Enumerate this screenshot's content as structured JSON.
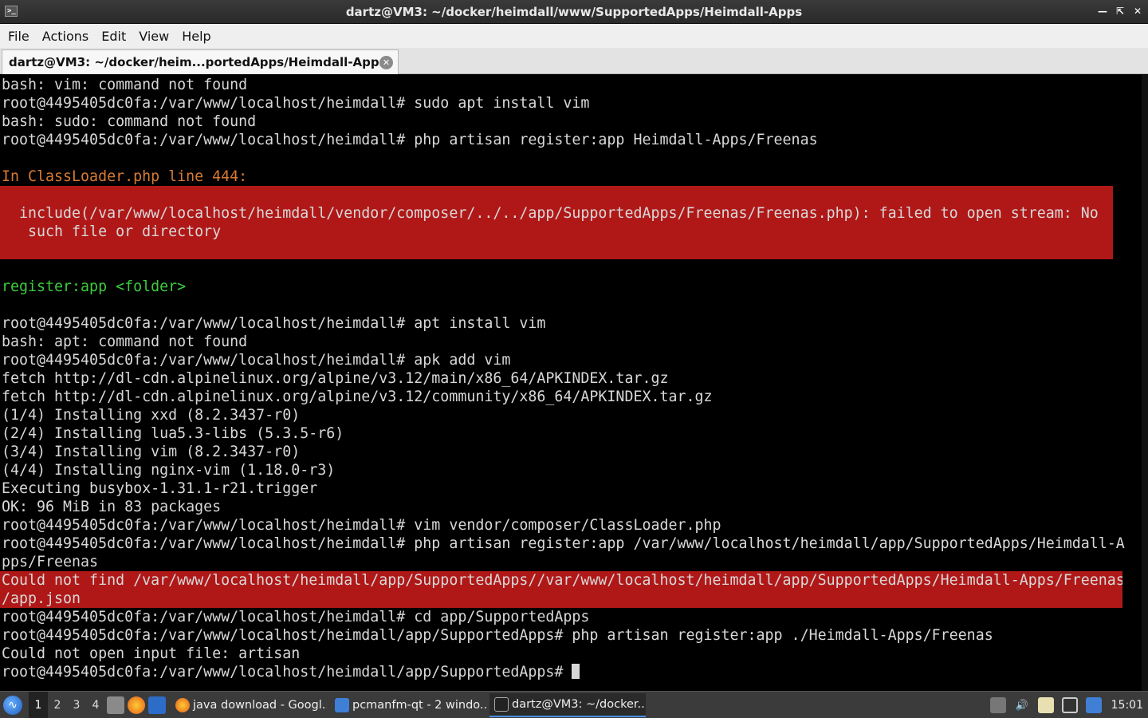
{
  "window": {
    "title": "dartz@VM3: ~/docker/heimdall/www/SupportedApps/Heimdall-Apps",
    "controls": [
      "minimize",
      "maximize",
      "close"
    ]
  },
  "menu": [
    "File",
    "Actions",
    "Edit",
    "View",
    "Help"
  ],
  "tab": {
    "label": "dartz@VM3: ~/docker/heim...portedApps/Heimdall-Apps",
    "close_icon": "close-icon"
  },
  "terminal": {
    "lines": [
      {
        "text": "bash: vim: command not found",
        "style": "plain"
      },
      {
        "text": "root@4495405dc0fa:/var/www/localhost/heimdall# sudo apt install vim",
        "style": "plain"
      },
      {
        "text": "bash: sudo: command not found",
        "style": "plain"
      },
      {
        "text": "root@4495405dc0fa:/var/www/localhost/heimdall# php artisan register:app Heimdall-Apps/Freenas",
        "style": "plain"
      },
      {
        "text": "",
        "style": "plain"
      },
      {
        "text": "In ClassLoader.php line 444:",
        "style": "orange"
      },
      {
        "text": "",
        "style": "errblock"
      },
      {
        "text": "  include(/var/www/localhost/heimdall/vendor/composer/../../app/SupportedApps/Freenas/Freenas.php): failed to open stream: No",
        "style": "errblock"
      },
      {
        "text": "   such file or directory",
        "style": "errblock"
      },
      {
        "text": "",
        "style": "errblock"
      },
      {
        "text": "",
        "style": "plain"
      },
      {
        "text": "register:app <folder>",
        "style": "green"
      },
      {
        "text": "",
        "style": "plain"
      },
      {
        "text": "root@4495405dc0fa:/var/www/localhost/heimdall# apt install vim",
        "style": "plain"
      },
      {
        "text": "bash: apt: command not found",
        "style": "plain"
      },
      {
        "text": "root@4495405dc0fa:/var/www/localhost/heimdall# apk add vim",
        "style": "plain"
      },
      {
        "text": "fetch http://dl-cdn.alpinelinux.org/alpine/v3.12/main/x86_64/APKINDEX.tar.gz",
        "style": "plain"
      },
      {
        "text": "fetch http://dl-cdn.alpinelinux.org/alpine/v3.12/community/x86_64/APKINDEX.tar.gz",
        "style": "plain"
      },
      {
        "text": "(1/4) Installing xxd (8.2.3437-r0)",
        "style": "plain"
      },
      {
        "text": "(2/4) Installing lua5.3-libs (5.3.5-r6)",
        "style": "plain"
      },
      {
        "text": "(3/4) Installing vim (8.2.3437-r0)",
        "style": "plain"
      },
      {
        "text": "(4/4) Installing nginx-vim (1.18.0-r3)",
        "style": "plain"
      },
      {
        "text": "Executing busybox-1.31.1-r21.trigger",
        "style": "plain"
      },
      {
        "text": "OK: 96 MiB in 83 packages",
        "style": "plain"
      },
      {
        "text": "root@4495405dc0fa:/var/www/localhost/heimdall# vim vendor/composer/ClassLoader.php",
        "style": "plain"
      },
      {
        "text": "root@4495405dc0fa:/var/www/localhost/heimdall# php artisan register:app /var/www/localhost/heimdall/app/SupportedApps/Heimdall-A",
        "style": "plain"
      },
      {
        "text": "pps/Freenas",
        "style": "plain"
      },
      {
        "text": "Could not find /var/www/localhost/heimdall/app/SupportedApps//var/www/localhost/heimdall/app/SupportedApps/Heimdall-Apps/Freenas",
        "style": "errred"
      },
      {
        "text": "/app.json",
        "style": "errred"
      },
      {
        "text": "root@4495405dc0fa:/var/www/localhost/heimdall# cd app/SupportedApps",
        "style": "plain"
      },
      {
        "text": "root@4495405dc0fa:/var/www/localhost/heimdall/app/SupportedApps# php artisan register:app ./Heimdall-Apps/Freenas",
        "style": "plain"
      },
      {
        "text": "Could not open input file: artisan",
        "style": "plain"
      },
      {
        "text": "root@4495405dc0fa:/var/www/localhost/heimdall/app/SupportedApps# ",
        "style": "prompt"
      }
    ]
  },
  "taskbar": {
    "start_icon": "start-menu-icon",
    "workspaces": [
      "1",
      "2",
      "3",
      "4"
    ],
    "active_workspace": "1",
    "quick_launch": [
      "file-manager-icon",
      "firefox-icon",
      "show-desktop-icon"
    ],
    "tasks": [
      {
        "label": "java download - Googl...",
        "icon": "firefox-icon",
        "active": false
      },
      {
        "label": "pcmanfm-qt - 2 windo...",
        "icon": "folder-icon",
        "active": false
      },
      {
        "label": "dartz@VM3: ~/docker...",
        "icon": "terminal-icon",
        "active": true
      }
    ],
    "tray": [
      "network-icon",
      "volume-icon",
      "clipboard-icon",
      "display-icon",
      "update-icon"
    ],
    "clock": "15:01"
  }
}
